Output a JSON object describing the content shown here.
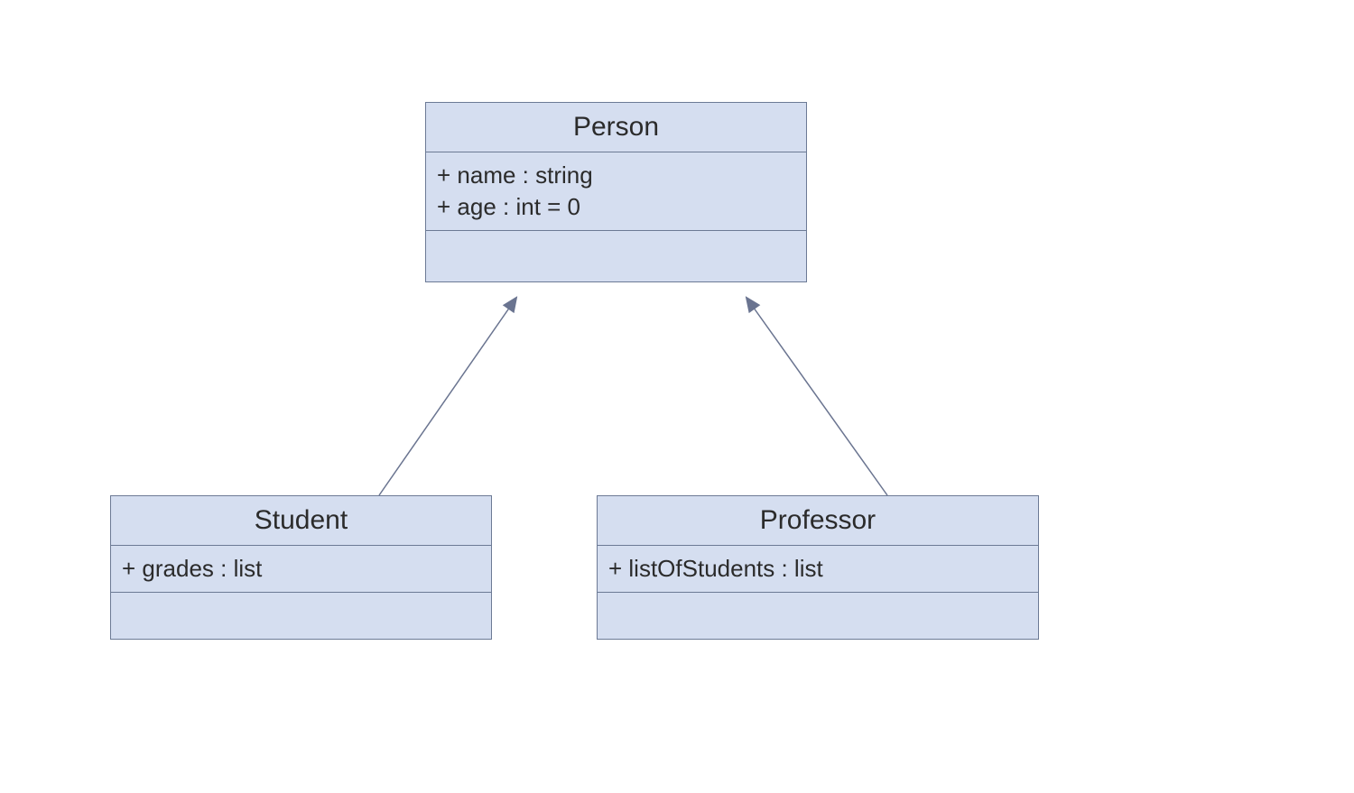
{
  "classes": {
    "person": {
      "name": "Person",
      "attrs": [
        "+ name : string",
        "+ age : int = 0"
      ]
    },
    "student": {
      "name": "Student",
      "attrs": [
        "+ grades : list"
      ]
    },
    "professor": {
      "name": "Professor",
      "attrs": [
        "+ listOfStudents : list"
      ]
    }
  },
  "relations": [
    {
      "from": "student",
      "to": "person",
      "type": "generalization"
    },
    {
      "from": "professor",
      "to": "person",
      "type": "generalization"
    }
  ]
}
